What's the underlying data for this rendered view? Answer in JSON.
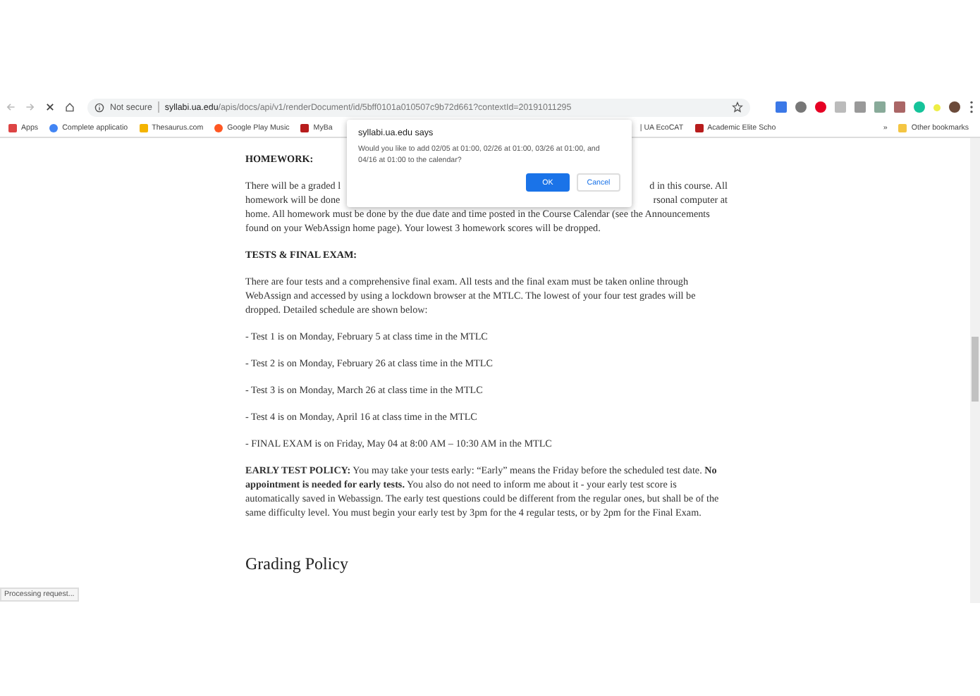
{
  "browser": {
    "nav": {
      "back_disabled": true,
      "forward_disabled": true
    },
    "security": "Not secure",
    "url_host": "syllabi.ua.edu",
    "url_path": "/apis/docs/api/v1/renderDocument/id/5bff0101a010507c9b72d661?contextId=20191011295",
    "bookmarks": [
      {
        "label": "Apps",
        "kind": "apps"
      },
      {
        "label": "Complete applicatio",
        "kind": "g"
      },
      {
        "label": "Thesaurus.com",
        "kind": "folder"
      },
      {
        "label": "Google Play Music",
        "kind": "music"
      },
      {
        "label": "MyBa",
        "kind": "doc"
      },
      {
        "label": "| UA EcoCAT",
        "kind": "text"
      },
      {
        "label": "Academic Elite Scho",
        "kind": "doc"
      }
    ],
    "overflow": "»",
    "other_bookmarks": "Other bookmarks",
    "status": "Processing request..."
  },
  "dialog": {
    "title": "syllabi.ua.edu says",
    "message": "Would you like to add 02/05 at 01:00, 02/26 at 01:00, 03/26 at 01:00, and 04/16 at 01:00 to the calendar?",
    "ok": "OK",
    "cancel": "Cancel"
  },
  "document": {
    "homework_heading": "HOMEWORK:",
    "homework_partial_lines": [
      {
        "left": "There will be a graded l",
        "right": "d in this course. All"
      },
      {
        "left": "homework will be done",
        "right": "rsonal computer at"
      }
    ],
    "homework_rest": "home. All homework must be done by the due date and time posted in the Course Calendar (see the Announcements found on your WebAssign home page). Your lowest 3 homework scores will be dropped.",
    "tests_heading": "TESTS & FINAL EXAM:",
    "tests_intro": "There are four tests and a comprehensive final exam. All tests and the final exam must be taken online through WebAssign and accessed by using a lockdown browser at the MTLC. The lowest of your four test grades will be dropped. Detailed schedule are shown below:",
    "schedule": [
      "- Test 1 is on Monday, February 5 at class time in the MTLC",
      "- Test 2 is on Monday, February 26 at class time in the MTLC",
      "- Test 3 is on Monday, March 26 at class time in the MTLC",
      "- Test 4 is on Monday, April 16 at class time in the MTLC",
      "- FINAL EXAM is on Friday, May 04 at 8:00 AM – 10:30 AM in the MTLC"
    ],
    "policy": "**EARLY TEST POLICY:** You may take your tests early: “Early” means the Friday before the scheduled test date. **No appointment is needed for early tests.** You also do not need to inform me about it - your early test score is automatically saved in Webassign. The early test questions could be different from the regular ones, but shall be of the same difficulty level. You must begin your early test by 3pm for the 4 regular tests, or by 2pm for the Final Exam.",
    "grading_heading": "Grading Policy"
  }
}
